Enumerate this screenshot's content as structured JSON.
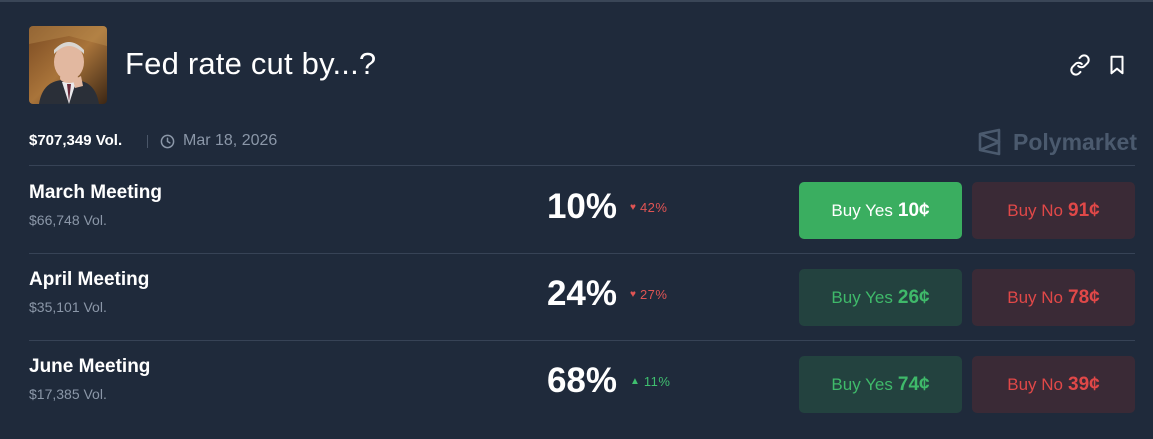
{
  "market": {
    "title": "Fed rate cut by...?",
    "volume": "$707,349 Vol.",
    "end_date": "Mar 18, 2026",
    "brand": "Polymarket"
  },
  "icons": {
    "link": "link-icon",
    "bookmark": "bookmark-icon",
    "clock": "clock-icon",
    "brand": "polymarket-logo-icon",
    "down": "triangle-down-icon",
    "up": "triangle-up-icon"
  },
  "colors": {
    "background": "#1f2a3b",
    "yes_active": "#3aae60",
    "yes_text": "#3fb96a",
    "no_text": "#e04848",
    "down": "#e05454",
    "up": "#3fbf6f"
  },
  "outcomes": [
    {
      "name": "March Meeting",
      "volume": "$66,748 Vol.",
      "percent": "10%",
      "change": "42%",
      "direction": "down",
      "yes_label": "Buy Yes",
      "yes_price": "10¢",
      "no_label": "Buy No",
      "no_price": "91¢",
      "yes_active": true
    },
    {
      "name": "April Meeting",
      "volume": "$35,101 Vol.",
      "percent": "24%",
      "change": "27%",
      "direction": "down",
      "yes_label": "Buy Yes",
      "yes_price": "26¢",
      "no_label": "Buy No",
      "no_price": "78¢",
      "yes_active": false
    },
    {
      "name": "June Meeting",
      "volume": "$17,385 Vol.",
      "percent": "68%",
      "change": "11%",
      "direction": "up",
      "yes_label": "Buy Yes",
      "yes_price": "74¢",
      "no_label": "Buy No",
      "no_price": "39¢",
      "yes_active": false
    }
  ]
}
